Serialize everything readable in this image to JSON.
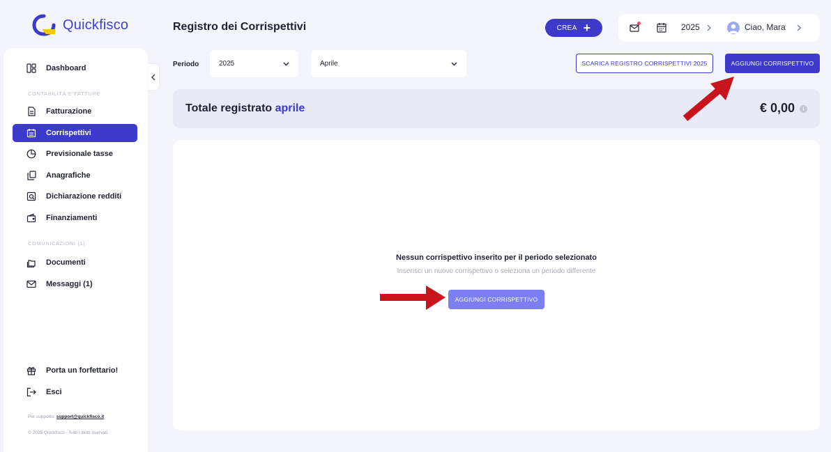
{
  "app": {
    "name": "Quickfisco"
  },
  "sidebar": {
    "items": [
      {
        "label": "Dashboard",
        "icon": "dashboard-icon"
      },
      {
        "label": "Fatturazione",
        "icon": "invoice-icon"
      },
      {
        "label": "Corrispettivi",
        "icon": "register-icon",
        "active": true
      },
      {
        "label": "Previsionale tasse",
        "icon": "pie-chart-icon"
      },
      {
        "label": "Anagrafiche",
        "icon": "contacts-icon"
      },
      {
        "label": "Dichiarazione redditi",
        "icon": "tax-return-icon"
      },
      {
        "label": "Finanziamenti",
        "icon": "wallet-icon"
      },
      {
        "label": "Documenti",
        "icon": "folder-icon"
      },
      {
        "label": "Messaggi (1)",
        "icon": "mail-icon"
      },
      {
        "label": "Porta un forfettario!",
        "icon": "gift-icon"
      },
      {
        "label": "Esci",
        "icon": "logout-icon"
      }
    ],
    "sections": {
      "accounting": "CONTABILITÀ E FATTURE",
      "communications": "COMUNICAZIONI (1)"
    },
    "support_prefix": "Per supporto:",
    "support_email": "support@quickfisco.it",
    "copyright": "© 2025 Quickfisco - Tutti i diritti riservati"
  },
  "header": {
    "title": "Registro dei Corrispettivi",
    "crea_label": "CREA",
    "year": "2025",
    "greeting": "Ciao, Mara"
  },
  "filters": {
    "periodo_label": "Periodo",
    "year_value": "2025",
    "month_value": "Aprile",
    "download_label": "SCARICA REGISTRO CORRISPETTIVI 2025",
    "add_label": "AGGIUNGI CORRISPETTIVO"
  },
  "total": {
    "label": "Totale registrato",
    "month": "aprile",
    "value": "€ 0,00"
  },
  "empty": {
    "title": "Nessun corrispettivo inserito per il periodo selezionato",
    "subtitle": "Inserisci un nuovo corrispettivo o seleziona un periodo differente",
    "button_label": "AGGIUNGI CORRISPETTIVO"
  },
  "colors": {
    "primary": "#3c3acb",
    "accent_yellow": "#f3c514",
    "annotation_arrow": "#c8141c"
  }
}
